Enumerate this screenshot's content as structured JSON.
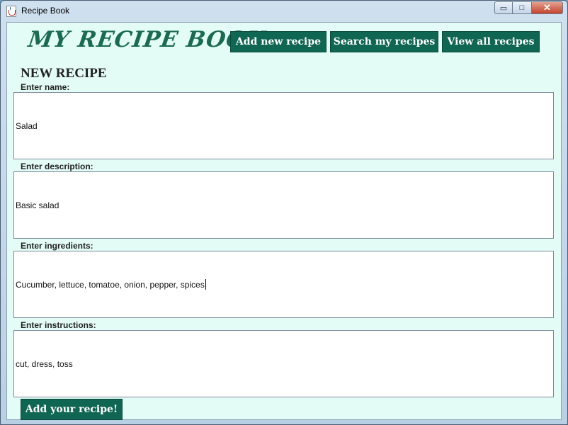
{
  "window": {
    "title": "Recipe Book",
    "min_glyph": "▭",
    "max_glyph": "□",
    "close_glyph": "✕"
  },
  "header": {
    "logo_text": "MY RECIPE BOOK",
    "nav": [
      {
        "label": "Add new recipe"
      },
      {
        "label": "Search my recipes"
      },
      {
        "label": "View all recipes"
      }
    ]
  },
  "form": {
    "heading": "NEW RECIPE",
    "fields": [
      {
        "label": "Enter name:",
        "value": "Salad"
      },
      {
        "label": "Enter description:",
        "value": "Basic salad"
      },
      {
        "label": "Enter ingredients:",
        "value": "Cucumber, lettuce, tomatoe, onion, pepper, spices"
      },
      {
        "label": "Enter instructions:",
        "value": "cut, dress, toss"
      }
    ],
    "submit_label": "Add your recipe!"
  },
  "colors": {
    "background": "#e3fcf5",
    "accent": "#0f6652",
    "logo": "#1a6b52"
  }
}
